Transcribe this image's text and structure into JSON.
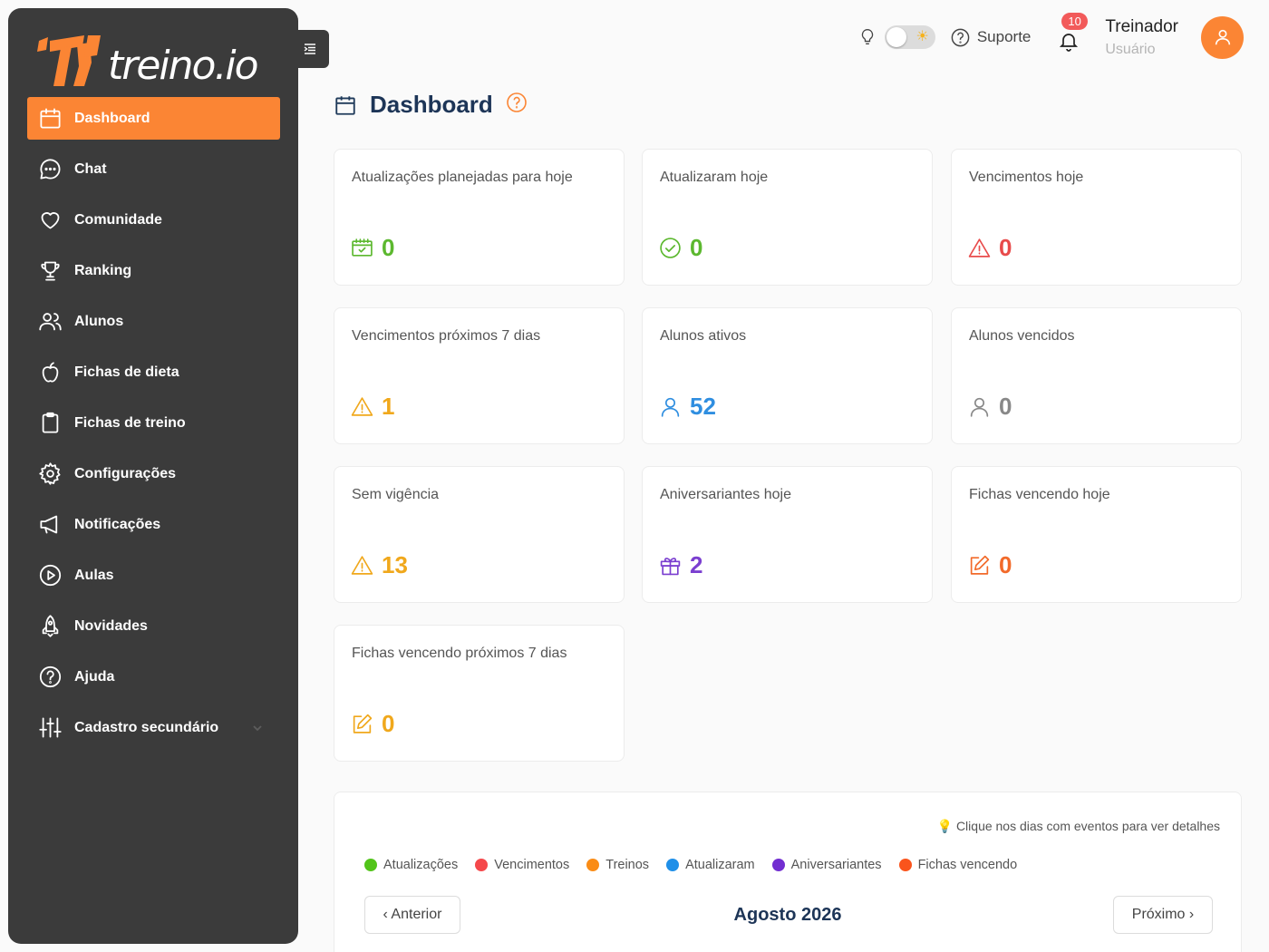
{
  "brand": {
    "name": "treino.io"
  },
  "sidebar": {
    "items": [
      {
        "label": "Dashboard",
        "icon": "calendar-icon",
        "active": true
      },
      {
        "label": "Chat",
        "icon": "chat-icon"
      },
      {
        "label": "Comunidade",
        "icon": "heart-icon"
      },
      {
        "label": "Ranking",
        "icon": "trophy-icon"
      },
      {
        "label": "Alunos",
        "icon": "users-icon"
      },
      {
        "label": "Fichas de dieta",
        "icon": "apple-icon"
      },
      {
        "label": "Fichas de treino",
        "icon": "clipboard-icon"
      },
      {
        "label": "Configurações",
        "icon": "gear-icon"
      },
      {
        "label": "Notificações",
        "icon": "megaphone-icon"
      },
      {
        "label": "Aulas",
        "icon": "play-icon"
      },
      {
        "label": "Novidades",
        "icon": "rocket-icon"
      },
      {
        "label": "Ajuda",
        "icon": "help-icon"
      },
      {
        "label": "Cadastro secundário",
        "icon": "sliders-icon"
      }
    ]
  },
  "topbar": {
    "support_label": "Suporte",
    "notifications_count": "10",
    "user_name": "Treinador",
    "user_role": "Usuário"
  },
  "page": {
    "title": "Dashboard"
  },
  "cards": [
    {
      "label": "Atualizações planejadas para hoje",
      "value": "0",
      "icon": "calendar-check-icon",
      "color": "#5cb82f"
    },
    {
      "label": "Atualizaram hoje",
      "value": "0",
      "icon": "check-circle-icon",
      "color": "#5cb82f"
    },
    {
      "label": "Vencimentos hoje",
      "value": "0",
      "icon": "warning-icon",
      "color": "#e84b4b"
    },
    {
      "label": "Vencimentos próximos 7 dias",
      "value": "1",
      "icon": "warning-icon",
      "color": "#f0a81c"
    },
    {
      "label": "Alunos ativos",
      "value": "52",
      "icon": "user-icon",
      "color": "#2f8ee0"
    },
    {
      "label": "Alunos vencidos",
      "value": "0",
      "icon": "user-icon",
      "color": "#888888"
    },
    {
      "label": "Sem vigência",
      "value": "13",
      "icon": "warning-icon",
      "color": "#f0a81c"
    },
    {
      "label": "Aniversariantes hoje",
      "value": "2",
      "icon": "gift-icon",
      "color": "#7b3fd0"
    },
    {
      "label": "Fichas vencendo hoje",
      "value": "0",
      "icon": "edit-icon",
      "color": "#f26a2a"
    },
    {
      "label": "Fichas vencendo próximos 7 dias",
      "value": "0",
      "icon": "edit-icon",
      "color": "#f0a81c"
    }
  ],
  "calendar": {
    "hint": "💡 Clique nos dias com eventos para ver detalhes",
    "legend": [
      {
        "label": "Atualizações",
        "color": "#52c41a"
      },
      {
        "label": "Vencimentos",
        "color": "#f5484b"
      },
      {
        "label": "Treinos",
        "color": "#fa8c16"
      },
      {
        "label": "Atualizaram",
        "color": "#1f8fe8"
      },
      {
        "label": "Aniversariantes",
        "color": "#722ed1"
      },
      {
        "label": "Fichas vencendo",
        "color": "#fa541c"
      }
    ],
    "prev_label": "‹ Anterior",
    "next_label": "Próximo ›",
    "month": "Agosto 2026"
  }
}
